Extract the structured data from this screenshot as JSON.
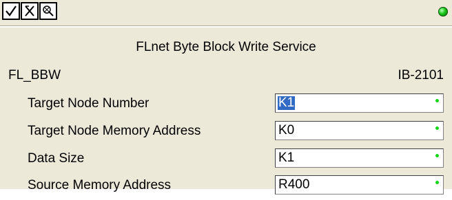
{
  "toolbar": {
    "buttons": [
      {
        "icon": "checkmark-icon"
      },
      {
        "icon": "cancel-x-icon"
      },
      {
        "icon": "help-icon"
      }
    ]
  },
  "status_led": {
    "icon": "status-led-icon",
    "color": "#18c818"
  },
  "title": "FLnet Byte Block Write Service",
  "instruction_name": "FL_BBW",
  "instruction_code": "IB-2101",
  "params": [
    {
      "label": "Target Node Number",
      "value": "K1"
    },
    {
      "label": "Target Node Memory Address",
      "value": "K0"
    },
    {
      "label": "Data Size",
      "value": "K1"
    },
    {
      "label": "Source Memory Address",
      "value": "R400"
    }
  ],
  "colors": {
    "panel_bg": "#ece9d8",
    "selection": "#316ac5",
    "valid_dot": "#14d714"
  }
}
